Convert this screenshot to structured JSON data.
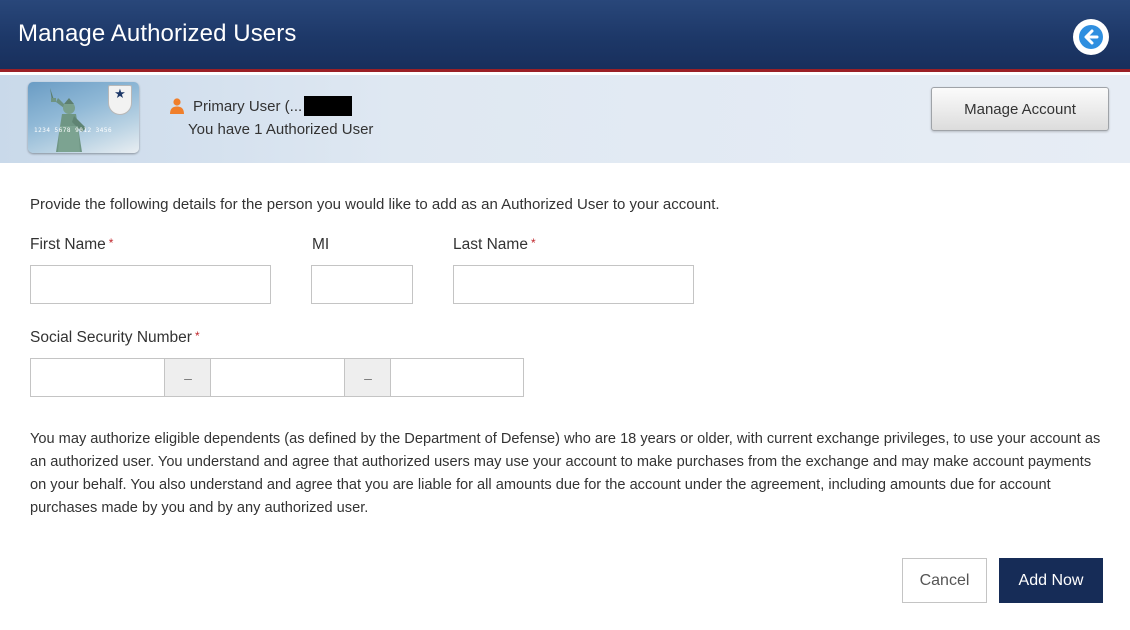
{
  "header": {
    "title": "Manage Authorized Users",
    "back_icon": "back-arrow-icon"
  },
  "user_bar": {
    "card_number": "1234 5678 9012 3456",
    "primary_user_label": "Primary User (...",
    "authorized_count_text": "You have 1 Authorized User",
    "manage_account_label": "Manage Account"
  },
  "form": {
    "instructions": "Provide the following details for the person you would like to add as an Authorized User to your account.",
    "required_marker": "*",
    "first_name_label": "First Name",
    "first_name_value": "",
    "mi_label": "MI",
    "mi_value": "",
    "last_name_label": "Last Name",
    "last_name_value": "",
    "ssn_label": "Social Security Number",
    "ssn_part1_value": "",
    "ssn_part2_value": "",
    "ssn_part3_value": "",
    "ssn_separator": "–"
  },
  "disclaimer": "You may authorize eligible dependents (as defined by the Department of Defense) who are 18 years or older, with current exchange privileges, to use your account as an authorized user. You understand and agree that authorized users may use your account to make purchases from the exchange and may make account payments on your behalf. You also understand and agree that you are liable for all amounts due for the account under the agreement, including amounts due for account purchases made by you and by any authorized user.",
  "actions": {
    "cancel_label": "Cancel",
    "add_now_label": "Add Now"
  },
  "colors": {
    "header_bg": "#1d3868",
    "header_accent": "#9b2026",
    "primary_button": "#162c57",
    "required": "#c0272d",
    "user_icon": "#f07f2b"
  }
}
